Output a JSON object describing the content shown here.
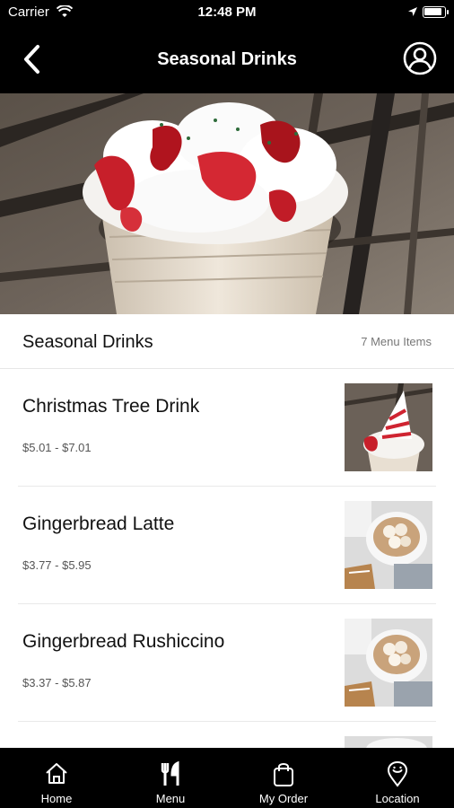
{
  "status_bar": {
    "carrier": "Carrier",
    "time": "12:48 PM"
  },
  "nav": {
    "title": "Seasonal Drinks",
    "back_icon": "chevron-left-icon",
    "profile_icon": "user-circle-icon"
  },
  "section": {
    "title": "Seasonal Drinks",
    "count": "7 Menu Items"
  },
  "items": [
    {
      "name": "Christmas Tree Drink",
      "price": "$5.01 - $7.01"
    },
    {
      "name": "Gingerbread Latte",
      "price": "$3.77 - $5.95"
    },
    {
      "name": "Gingerbread Rushiccino",
      "price": "$3.37 - $5.87"
    }
  ],
  "tabs": [
    {
      "label": "Home",
      "icon": "home-icon"
    },
    {
      "label": "Menu",
      "icon": "utensils-icon"
    },
    {
      "label": "My Order",
      "icon": "shopping-bag-icon"
    },
    {
      "label": "Location",
      "icon": "map-pin-icon"
    }
  ],
  "colors": {
    "bar_background": "#000000",
    "bar_foreground": "#ffffff",
    "divider": "#e6e6e6",
    "secondary_text": "#777777"
  }
}
